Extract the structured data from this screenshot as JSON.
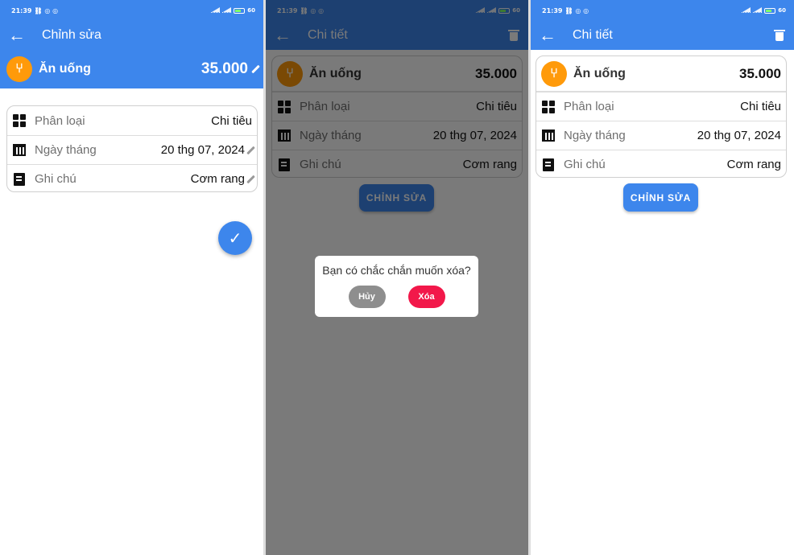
{
  "status": {
    "time": "21:39",
    "battery": "60"
  },
  "edit_screen": {
    "title": "Chỉnh sửa",
    "category_name": "Ăn uống",
    "amount": "35.000",
    "rows": [
      {
        "label": "Phân loại",
        "value": "Chi tiêu"
      },
      {
        "label": "Ngày tháng",
        "value": "20 thg 07, 2024"
      },
      {
        "label": "Ghi chú",
        "value": "Cơm rang"
      }
    ]
  },
  "detail_screen": {
    "title": "Chi tiết",
    "category_name": "Ăn uống",
    "amount": "35.000",
    "rows": [
      {
        "label": "Phân loại",
        "value": "Chi tiêu"
      },
      {
        "label": "Ngày tháng",
        "value": "20 thg 07, 2024"
      },
      {
        "label": "Ghi chú",
        "value": "Cơm rang"
      }
    ],
    "edit_button": "CHỈNH SỬA"
  },
  "dialog": {
    "message": "Bạn có chắc chắn muốn xóa?",
    "cancel": "Hủy",
    "delete": "Xóa"
  },
  "icons": {
    "back": "arrow-left-icon",
    "trash": "trash-icon",
    "category": "fork-knife-icon",
    "type": "grid-icon",
    "date": "calendar-icon",
    "note": "note-icon",
    "edit": "pencil-icon",
    "confirm": "check-icon"
  },
  "colors": {
    "primary": "#3d86ec",
    "category": "#ff9a0a",
    "cancel": "#8e8e8e",
    "delete": "#f2184a"
  }
}
